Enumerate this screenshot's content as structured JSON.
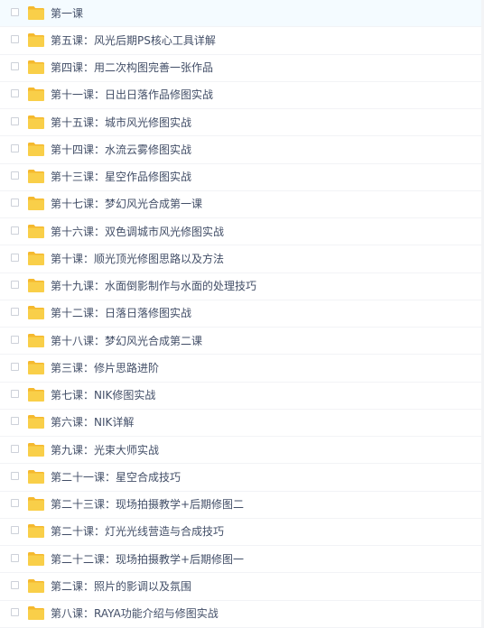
{
  "colors": {
    "folder": "#f9cf49",
    "folder_tab": "#f5b92e",
    "text": "#424e67",
    "divider": "#f2f3f6"
  },
  "icon": "folder-icon",
  "folders": [
    "第一课",
    "第五课：风光后期PS核心工具详解",
    "第四课：用二次构图完善一张作品",
    "第十一课：日出日落作品修图实战",
    "第十五课：城市风光修图实战",
    "第十四课：水流云雾修图实战",
    "第十三课：星空作品修图实战",
    "第十七课：梦幻风光合成第一课",
    "第十六课：双色调城市风光修图实战",
    "第十课：顺光顶光修图思路以及方法",
    "第十九课：水面倒影制作与水面的处理技巧",
    "第十二课：日落日落修图实战",
    "第十八课：梦幻风光合成第二课",
    "第三课：修片思路进阶",
    "第七课：NIK修图实战",
    "第六课：NIK详解",
    "第九课：光束大师实战",
    "第二十一课：星空合成技巧",
    "第二十三课：现场拍摄教学+后期修图二",
    "第二十课：灯光光线营造与合成技巧",
    "第二十二课：现场拍摄教学+后期修图一",
    "第二课：照片的影调以及氛围",
    "第八课：RAYA功能介绍与修图实战"
  ]
}
